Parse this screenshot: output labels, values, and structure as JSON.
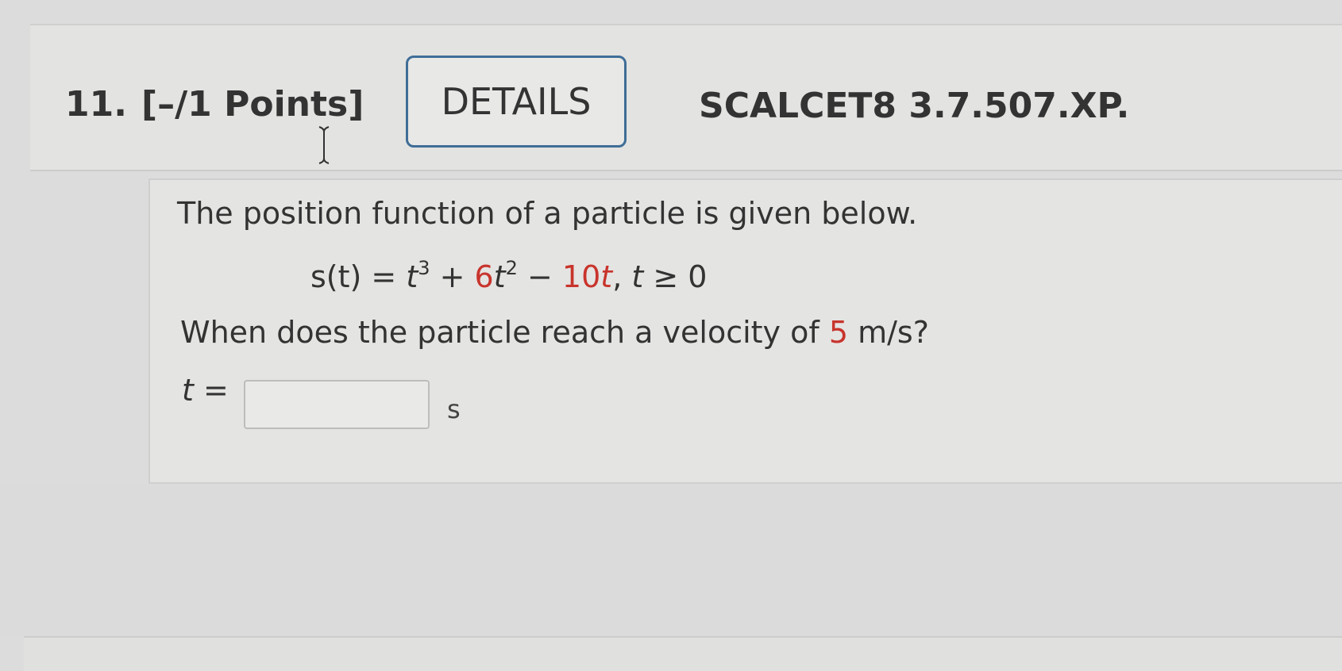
{
  "question": {
    "number": "11.",
    "points": "[–/1 Points]",
    "details_label": "DETAILS",
    "problem_id": "SCALCET8 3.7.507.XP."
  },
  "problem": {
    "intro": "The position function of a particle is given below.",
    "equation": {
      "lhs": "s(t) = ",
      "t1": "t",
      "exp1": "3",
      "plus": " + ",
      "coef2": "6",
      "t2": "t",
      "exp2": "2",
      "minus": " − ",
      "coef3": "10",
      "t3": "t",
      "comma": ", ",
      "t4": "t",
      "cond": " ≥ 0"
    },
    "question_before": "When does the particle reach a velocity of ",
    "velocity_value": "5",
    "question_after": " m/s?",
    "answer_var": "t",
    "answer_eq": " =",
    "answer_value": "",
    "answer_unit": "s"
  },
  "colors": {
    "accent_border": "#3f6e97",
    "highlight_red": "#c8342c"
  },
  "icons": {
    "cursor": "text-cursor-icon"
  }
}
